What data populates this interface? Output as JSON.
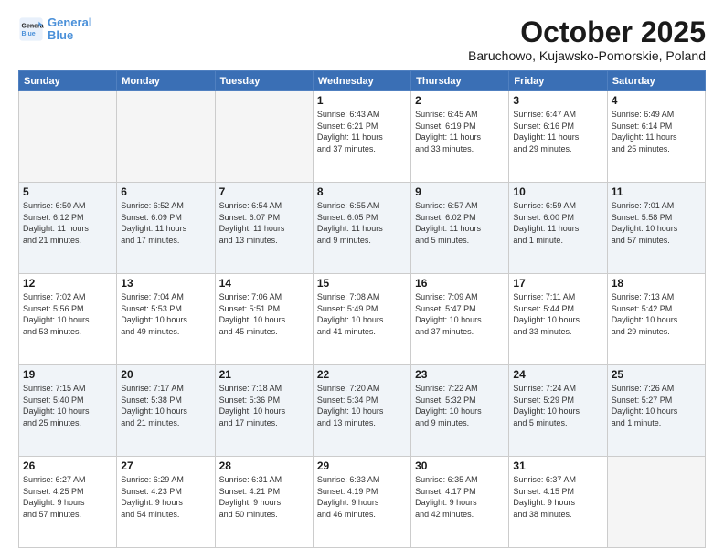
{
  "logo": {
    "line1": "General",
    "line2": "Blue"
  },
  "header": {
    "month": "October 2025",
    "location": "Baruchowo, Kujawsko-Pomorskie, Poland"
  },
  "weekdays": [
    "Sunday",
    "Monday",
    "Tuesday",
    "Wednesday",
    "Thursday",
    "Friday",
    "Saturday"
  ],
  "weeks": [
    [
      {
        "day": "",
        "info": ""
      },
      {
        "day": "",
        "info": ""
      },
      {
        "day": "",
        "info": ""
      },
      {
        "day": "1",
        "info": "Sunrise: 6:43 AM\nSunset: 6:21 PM\nDaylight: 11 hours\nand 37 minutes."
      },
      {
        "day": "2",
        "info": "Sunrise: 6:45 AM\nSunset: 6:19 PM\nDaylight: 11 hours\nand 33 minutes."
      },
      {
        "day": "3",
        "info": "Sunrise: 6:47 AM\nSunset: 6:16 PM\nDaylight: 11 hours\nand 29 minutes."
      },
      {
        "day": "4",
        "info": "Sunrise: 6:49 AM\nSunset: 6:14 PM\nDaylight: 11 hours\nand 25 minutes."
      }
    ],
    [
      {
        "day": "5",
        "info": "Sunrise: 6:50 AM\nSunset: 6:12 PM\nDaylight: 11 hours\nand 21 minutes."
      },
      {
        "day": "6",
        "info": "Sunrise: 6:52 AM\nSunset: 6:09 PM\nDaylight: 11 hours\nand 17 minutes."
      },
      {
        "day": "7",
        "info": "Sunrise: 6:54 AM\nSunset: 6:07 PM\nDaylight: 11 hours\nand 13 minutes."
      },
      {
        "day": "8",
        "info": "Sunrise: 6:55 AM\nSunset: 6:05 PM\nDaylight: 11 hours\nand 9 minutes."
      },
      {
        "day": "9",
        "info": "Sunrise: 6:57 AM\nSunset: 6:02 PM\nDaylight: 11 hours\nand 5 minutes."
      },
      {
        "day": "10",
        "info": "Sunrise: 6:59 AM\nSunset: 6:00 PM\nDaylight: 11 hours\nand 1 minute."
      },
      {
        "day": "11",
        "info": "Sunrise: 7:01 AM\nSunset: 5:58 PM\nDaylight: 10 hours\nand 57 minutes."
      }
    ],
    [
      {
        "day": "12",
        "info": "Sunrise: 7:02 AM\nSunset: 5:56 PM\nDaylight: 10 hours\nand 53 minutes."
      },
      {
        "day": "13",
        "info": "Sunrise: 7:04 AM\nSunset: 5:53 PM\nDaylight: 10 hours\nand 49 minutes."
      },
      {
        "day": "14",
        "info": "Sunrise: 7:06 AM\nSunset: 5:51 PM\nDaylight: 10 hours\nand 45 minutes."
      },
      {
        "day": "15",
        "info": "Sunrise: 7:08 AM\nSunset: 5:49 PM\nDaylight: 10 hours\nand 41 minutes."
      },
      {
        "day": "16",
        "info": "Sunrise: 7:09 AM\nSunset: 5:47 PM\nDaylight: 10 hours\nand 37 minutes."
      },
      {
        "day": "17",
        "info": "Sunrise: 7:11 AM\nSunset: 5:44 PM\nDaylight: 10 hours\nand 33 minutes."
      },
      {
        "day": "18",
        "info": "Sunrise: 7:13 AM\nSunset: 5:42 PM\nDaylight: 10 hours\nand 29 minutes."
      }
    ],
    [
      {
        "day": "19",
        "info": "Sunrise: 7:15 AM\nSunset: 5:40 PM\nDaylight: 10 hours\nand 25 minutes."
      },
      {
        "day": "20",
        "info": "Sunrise: 7:17 AM\nSunset: 5:38 PM\nDaylight: 10 hours\nand 21 minutes."
      },
      {
        "day": "21",
        "info": "Sunrise: 7:18 AM\nSunset: 5:36 PM\nDaylight: 10 hours\nand 17 minutes."
      },
      {
        "day": "22",
        "info": "Sunrise: 7:20 AM\nSunset: 5:34 PM\nDaylight: 10 hours\nand 13 minutes."
      },
      {
        "day": "23",
        "info": "Sunrise: 7:22 AM\nSunset: 5:32 PM\nDaylight: 10 hours\nand 9 minutes."
      },
      {
        "day": "24",
        "info": "Sunrise: 7:24 AM\nSunset: 5:29 PM\nDaylight: 10 hours\nand 5 minutes."
      },
      {
        "day": "25",
        "info": "Sunrise: 7:26 AM\nSunset: 5:27 PM\nDaylight: 10 hours\nand 1 minute."
      }
    ],
    [
      {
        "day": "26",
        "info": "Sunrise: 6:27 AM\nSunset: 4:25 PM\nDaylight: 9 hours\nand 57 minutes."
      },
      {
        "day": "27",
        "info": "Sunrise: 6:29 AM\nSunset: 4:23 PM\nDaylight: 9 hours\nand 54 minutes."
      },
      {
        "day": "28",
        "info": "Sunrise: 6:31 AM\nSunset: 4:21 PM\nDaylight: 9 hours\nand 50 minutes."
      },
      {
        "day": "29",
        "info": "Sunrise: 6:33 AM\nSunset: 4:19 PM\nDaylight: 9 hours\nand 46 minutes."
      },
      {
        "day": "30",
        "info": "Sunrise: 6:35 AM\nSunset: 4:17 PM\nDaylight: 9 hours\nand 42 minutes."
      },
      {
        "day": "31",
        "info": "Sunrise: 6:37 AM\nSunset: 4:15 PM\nDaylight: 9 hours\nand 38 minutes."
      },
      {
        "day": "",
        "info": ""
      }
    ]
  ]
}
